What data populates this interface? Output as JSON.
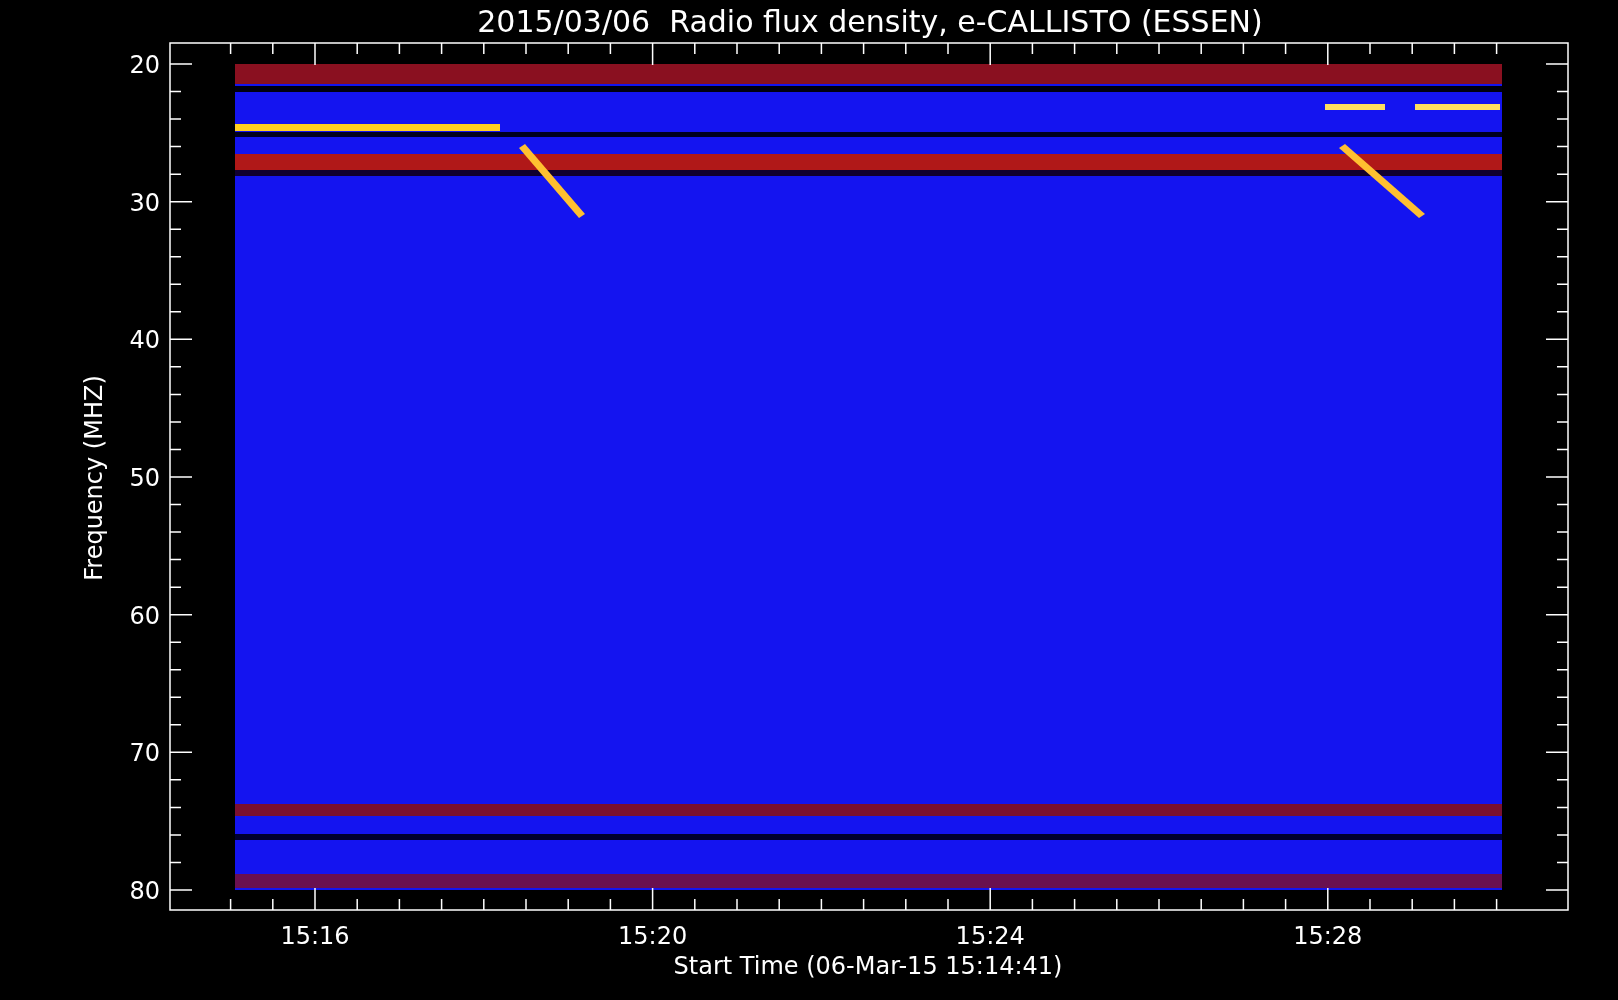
{
  "title": "2015/03/06  Radio flux density, e-CALLISTO (ESSEN)",
  "y_axis": {
    "label": "Frequency (MHZ)",
    "ticks": [
      "20",
      "30",
      "40",
      "50",
      "60",
      "70",
      "80"
    ]
  },
  "x_axis": {
    "label": "Start Time (06-Mar-15 15:14:41)",
    "ticks": [
      "15:16",
      "15:20",
      "15:24",
      "15:28"
    ]
  }
}
